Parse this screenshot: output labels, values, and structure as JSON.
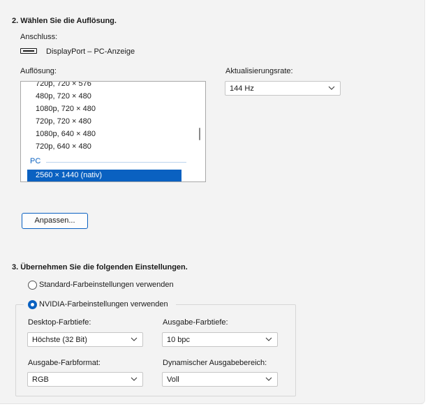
{
  "section2": {
    "title": "2. Wählen Sie die Auflösung.",
    "connection_label": "Anschluss:",
    "connection_value": "DisplayPort – PC-Anzeige",
    "resolution_label": "Auflösung:",
    "resolutions_partial": "720p, 720 × 576",
    "resolutions": [
      "480p, 720 × 480",
      "1080p, 720 × 480",
      "720p, 720 × 480",
      "1080p, 640 × 480",
      "720p, 640 × 480"
    ],
    "group_pc": "PC",
    "selected_resolution": "2560 × 1440 (nativ)",
    "refresh_label": "Aktualisierungsrate:",
    "refresh_value": "144 Hz",
    "customize_button": "Anpassen..."
  },
  "section3": {
    "title": "3. Übernehmen Sie die folgenden Einstellungen.",
    "radio_default": "Standard-Farbeinstellungen verwenden",
    "radio_nvidia": "NVIDIA-Farbeinstellungen verwenden",
    "radio_selected": "nvidia",
    "desktop_depth_label": "Desktop-Farbtiefe:",
    "desktop_depth_value": "Höchste (32 Bit)",
    "output_depth_label": "Ausgabe-Farbtiefe:",
    "output_depth_value": "10 bpc",
    "output_format_label": "Ausgabe-Farbformat:",
    "output_format_value": "RGB",
    "dynamic_range_label": "Dynamischer Ausgabebereich:",
    "dynamic_range_value": "Voll"
  },
  "colors": {
    "accent": "#0a61c1",
    "panel": "#f3f3f3",
    "border": "#a8a8a8"
  }
}
